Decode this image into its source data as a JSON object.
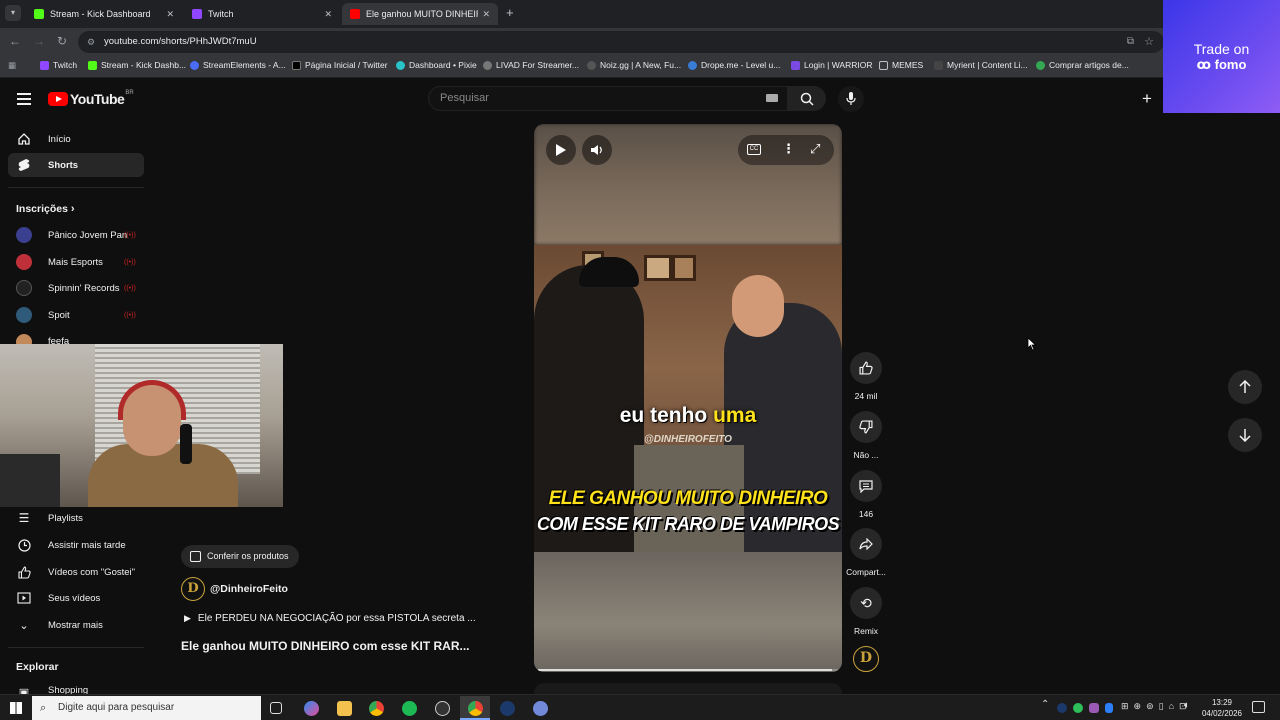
{
  "browser": {
    "tabs": [
      {
        "title": "Stream - Kick Dashboard",
        "color": "#53fc18"
      },
      {
        "title": "Twitch",
        "color": "#9146ff"
      },
      {
        "title": "Ele ganhou MUITO DINHEIRO",
        "color": "#ff0000"
      }
    ],
    "url": "youtube.com/shorts/PHhJWDt7muU",
    "bookmarks": [
      "Twitch",
      "Stream - Kick Dashb...",
      "StreamElements - A...",
      "Página Inicial / Twitter",
      "Dashboard • Pixie",
      "LIVAD For Streamer...",
      "Noiz.gg | A New, Fu...",
      "Drope.me - Level u...",
      "Login | WARRIOR",
      "MEMES",
      "Myrient | Content Li...",
      "Comprar artigos de..."
    ]
  },
  "ad": {
    "line1": "Trade on",
    "line2": "fomo"
  },
  "youtube": {
    "logo_text": "YouTube",
    "logo_region": "BR",
    "search_placeholder": "Pesquisar"
  },
  "sidebar": {
    "items": [
      {
        "label": "Início",
        "icon": "home-icon"
      },
      {
        "label": "Shorts",
        "icon": "shorts-icon"
      }
    ],
    "subscriptions_title": "Inscrições",
    "subscriptions": [
      {
        "label": "Pânico Jovem Pan",
        "color": "#3a3f8f"
      },
      {
        "label": "Mais Esports",
        "color": "#c0303a"
      },
      {
        "label": "Spinnin' Records",
        "color": "#222222"
      },
      {
        "label": "Spoit",
        "color": "#2f5a7a"
      },
      {
        "label": "feefa",
        "color": "#c28a5a"
      }
    ],
    "you_items": [
      {
        "label": "Playlists",
        "icon": "playlist-icon"
      },
      {
        "label": "Assistir mais tarde",
        "icon": "clock-icon"
      },
      {
        "label": "Vídeos com \"Gostei\"",
        "icon": "like-icon"
      },
      {
        "label": "Seus vídeos",
        "icon": "video-icon"
      },
      {
        "label": "Mostrar mais",
        "icon": "chevron-down-icon"
      }
    ],
    "explore_title": "Explorar",
    "explore_items": [
      {
        "label": "Shopping",
        "icon": "bag-icon"
      }
    ]
  },
  "short": {
    "caption_white": "eu tenho",
    "caption_yellow": "uma",
    "watermark": "@DINHEIROFEITO",
    "title_overlay_1": "ELE GANHOU MUITO DINHEIRO",
    "title_overlay_2": "COM ESSE KIT RARO DE VAMPIROS",
    "products_label": "Conferir os produtos",
    "channel": "@DinheiroFeito",
    "related": "Ele PERDEU NA NEGOCIAÇÃO por essa PISTOLA secreta ...",
    "title": "Ele ganhou MUITO DINHEIRO com esse KIT RAR...",
    "progress": 0.98
  },
  "actions": {
    "likes": "24 mil",
    "dislike": "Não ...",
    "comments": "146",
    "share": "Compart...",
    "remix": "Remix"
  },
  "taskbar": {
    "search_placeholder": "Digite aqui para pesquisar",
    "time": "13:29",
    "date": "04/02/2026"
  }
}
